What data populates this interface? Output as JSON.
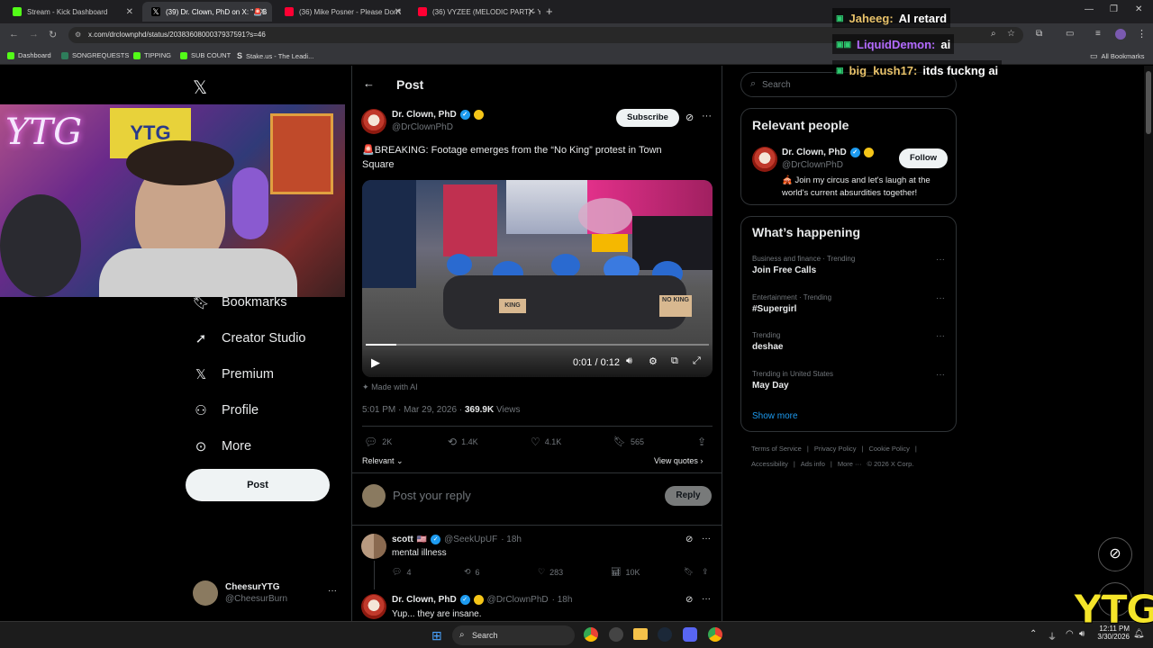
{
  "tabs": [
    {
      "label": "Stream - Kick Dashboard",
      "color": "#53fc18"
    },
    {
      "label": "(39) Dr. Clown, PhD on X: \"🚨B",
      "color": "#000000"
    },
    {
      "label": "(36) Mike Posner - Please Don't",
      "color": "#ff0033"
    },
    {
      "label": "(36) VYZEE (MELODIC PART) - Y",
      "color": "#ff0033"
    }
  ],
  "address": {
    "url": "x.com/drclownphd/status/2038360800037937591?s=46"
  },
  "bookmarks": [
    "Dashboard",
    "SONGREQUESTS",
    "TIPPING",
    "SUB COUNT",
    "Stake.us - The Leadi...",
    "All Bookmarks"
  ],
  "chat": [
    {
      "user": "Jaheeg:",
      "message": "AI retard",
      "color": "#e8c26a"
    },
    {
      "user": "LiquidDemon:",
      "message": "ai",
      "color": "#b36bff"
    },
    {
      "user": "big_kush17:",
      "message": "itds fuckng ai",
      "color": "#e8c26a"
    }
  ],
  "nav": {
    "items": [
      "Bookmarks",
      "Creator Studio",
      "Premium",
      "Profile",
      "More"
    ],
    "post_label": "Post",
    "account_name": "CheesurYTG",
    "account_handle": "@CheesurBurn"
  },
  "post": {
    "header_title": "Post",
    "author_name": "Dr. Clown, PhD",
    "author_handle": "@DrClownPhD",
    "subscribe_label": "Subscribe",
    "text_line1": "🚨BREAKING: Footage emerges from the “No King” protest in Town",
    "text_line2": "Square",
    "video_time": "0:01 / 0:12",
    "video_progress": 0.09,
    "made_with_ai": "Made with AI",
    "time": "5:01 PM · Mar 29, 2026 · ",
    "views_count": "369.9K",
    "views_label": " Views",
    "replies": "2K",
    "reposts": "1.4K",
    "likes": "4.1K",
    "bookmarks": "565",
    "sort_label": "Relevant",
    "view_quotes": "View quotes",
    "reply_placeholder": "Post your reply",
    "reply_button": "Reply",
    "sign_texts": [
      "KING",
      "NO KING"
    ]
  },
  "replies": [
    {
      "name": "scott",
      "handle": "@SeekUpUF",
      "time": "· 18h",
      "text": "mental illness",
      "replies": "4",
      "reposts": "6",
      "likes": "283",
      "views": "10K"
    },
    {
      "name": "Dr. Clown, PhD",
      "handle": "@DrClownPhD",
      "time": "· 18h",
      "text": "Yup... they are insane."
    }
  ],
  "sidebar": {
    "search_placeholder": "Search",
    "relevant_title": "Relevant people",
    "person_name": "Dr. Clown, PhD",
    "person_handle": "@DrClownPhD",
    "follow_label": "Follow",
    "person_bio1": "🎪 Join my circus and let's laugh at the",
    "person_bio2": "world's current absurdities together!",
    "happening_title": "What’s happening",
    "trends": [
      {
        "category": "Business and finance · Trending",
        "name": "Join Free Calls"
      },
      {
        "category": "Entertainment · Trending",
        "name": "#Supergirl"
      },
      {
        "category": "Trending",
        "name": "deshae"
      },
      {
        "category": "Trending in United States",
        "name": "May Day"
      }
    ],
    "show_more": "Show more",
    "footer_row1": [
      "Terms of Service",
      "|",
      "Privacy Policy",
      "|",
      "Cookie Policy",
      "|"
    ],
    "footer_row2": [
      "Accessibility",
      "|",
      "Ads info",
      "|",
      "More ···",
      "© 2026 X Corp."
    ]
  },
  "webcam": {
    "banner_text": "YTG",
    "neon_text": "YTG"
  },
  "taskbar": {
    "search_label": "Search",
    "time": "12:11 PM",
    "date": "3/30/2026",
    "watermark": "YTG"
  }
}
